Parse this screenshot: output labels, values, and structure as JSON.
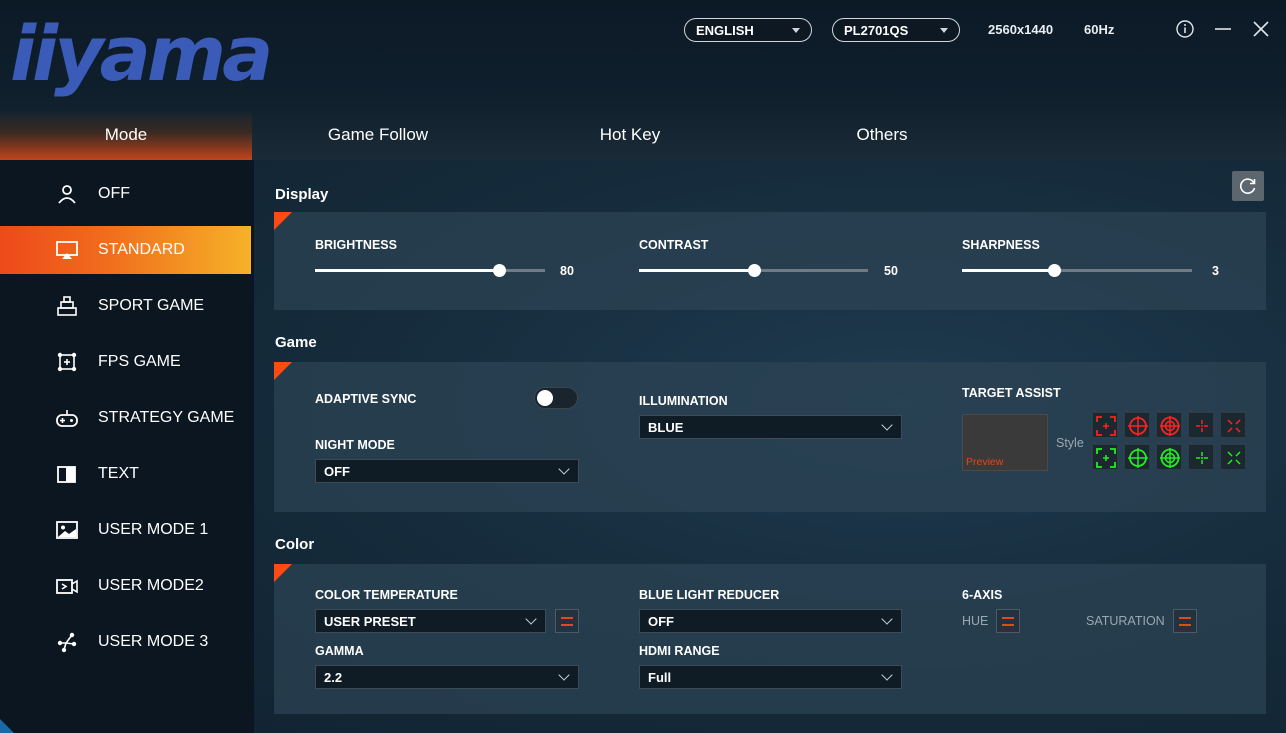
{
  "header": {
    "logo": "iiyama",
    "language": "ENGLISH",
    "model": "PL2701QS",
    "resolution": "2560x1440",
    "refresh": "60Hz"
  },
  "tabs": [
    {
      "label": "Mode",
      "active": true
    },
    {
      "label": "Game Follow",
      "active": false
    },
    {
      "label": "Hot Key",
      "active": false
    },
    {
      "label": "Others",
      "active": false
    }
  ],
  "sidebar": {
    "items": [
      {
        "label": "OFF",
        "icon": "person-icon",
        "active": false
      },
      {
        "label": "STANDARD",
        "icon": "monitor-icon",
        "active": true
      },
      {
        "label": "SPORT GAME",
        "icon": "podium-icon",
        "active": false
      },
      {
        "label": "FPS GAME",
        "icon": "target-icon",
        "active": false
      },
      {
        "label": "STRATEGY GAME",
        "icon": "gamepad-icon",
        "active": false
      },
      {
        "label": "TEXT",
        "icon": "book-icon",
        "active": false
      },
      {
        "label": "USER MODE 1",
        "icon": "image-icon",
        "active": false
      },
      {
        "label": "USER MODE2",
        "icon": "video-icon",
        "active": false
      },
      {
        "label": "USER MODE 3",
        "icon": "network-icon",
        "active": false
      }
    ]
  },
  "display": {
    "title": "Display",
    "brightness": {
      "label": "BRIGHTNESS",
      "value": "80",
      "level": 0.8
    },
    "contrast": {
      "label": "CONTRAST",
      "value": "50",
      "level": 0.5
    },
    "sharpness": {
      "label": "SHARPNESS",
      "value": "3",
      "level": 0.4
    }
  },
  "game": {
    "title": "Game",
    "adaptive_sync": {
      "label": "ADAPTIVE SYNC",
      "on": false
    },
    "night_mode": {
      "label": "NIGHT MODE",
      "value": "OFF"
    },
    "illumination": {
      "label": "ILLUMINATION",
      "value": "BLUE"
    },
    "target_assist": {
      "label": "TARGET ASSIST",
      "preview": "Preview",
      "style_label": "Style"
    }
  },
  "color": {
    "title": "Color",
    "color_temperature": {
      "label": "COLOR TEMPERATURE",
      "value": "USER PRESET"
    },
    "gamma": {
      "label": "GAMMA",
      "value": "2.2"
    },
    "blue_light_reducer": {
      "label": "BLUE LIGHT REDUCER",
      "value": "OFF"
    },
    "hdmi_range": {
      "label": "HDMI RANGE",
      "value": "Full"
    },
    "six_axis": {
      "label": "6-AXIS",
      "hue": "HUE",
      "saturation": "SATURATION"
    }
  },
  "colors": {
    "accent_orange": "#ff4a14",
    "crosshair_red": "#ff2020",
    "crosshair_green": "#22ee22",
    "logo_blue": "#3a5bb8"
  }
}
